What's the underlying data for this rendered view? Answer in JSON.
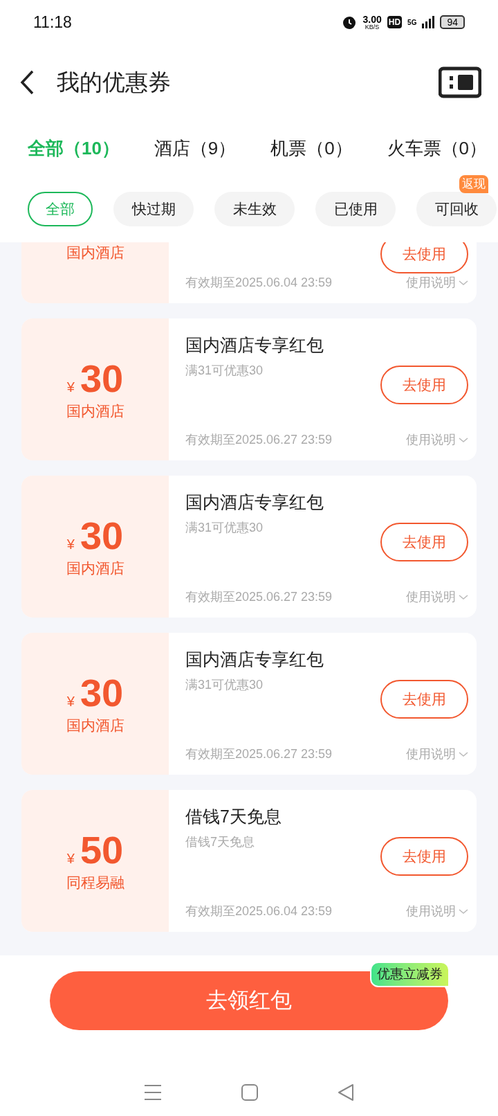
{
  "status_bar": {
    "time": "11:18",
    "speed": "3.00",
    "speed_unit": "KB/S",
    "hd": "HD",
    "network": "5G",
    "battery": "94"
  },
  "header": {
    "title": "我的优惠券"
  },
  "tabs": [
    {
      "label": "全部（10）",
      "selected": true
    },
    {
      "label": "酒店（9）",
      "selected": false
    },
    {
      "label": "机票（0）",
      "selected": false
    },
    {
      "label": "火车票（0）",
      "selected": false
    }
  ],
  "filters": [
    {
      "label": "全部",
      "selected": true
    },
    {
      "label": "快过期",
      "selected": false
    },
    {
      "label": "未生效",
      "selected": false
    },
    {
      "label": "已使用",
      "selected": false
    },
    {
      "label": "可回收",
      "selected": false,
      "badge": "返现"
    }
  ],
  "coupons": [
    {
      "category": "国内酒店",
      "button": "去使用",
      "validity": "有效期至2025.06.04 23:59",
      "instructions": "使用说明"
    },
    {
      "currency": "¥",
      "amount": "30",
      "category": "国内酒店",
      "title": "国内酒店专享红包",
      "condition": "满31可优惠30",
      "button": "去使用",
      "validity": "有效期至2025.06.27 23:59",
      "instructions": "使用说明"
    },
    {
      "currency": "¥",
      "amount": "30",
      "category": "国内酒店",
      "title": "国内酒店专享红包",
      "condition": "满31可优惠30",
      "button": "去使用",
      "validity": "有效期至2025.06.27 23:59",
      "instructions": "使用说明"
    },
    {
      "currency": "¥",
      "amount": "30",
      "category": "国内酒店",
      "title": "国内酒店专享红包",
      "condition": "满31可优惠30",
      "button": "去使用",
      "validity": "有效期至2025.06.27 23:59",
      "instructions": "使用说明"
    },
    {
      "currency": "¥",
      "amount": "50",
      "category": "同程易融",
      "title": "借钱7天免息",
      "condition": "借钱7天免息",
      "button": "去使用",
      "validity": "有效期至2025.06.04 23:59",
      "instructions": "使用说明"
    }
  ],
  "bottom": {
    "button": "去领红包",
    "badge": "优惠立减券"
  }
}
